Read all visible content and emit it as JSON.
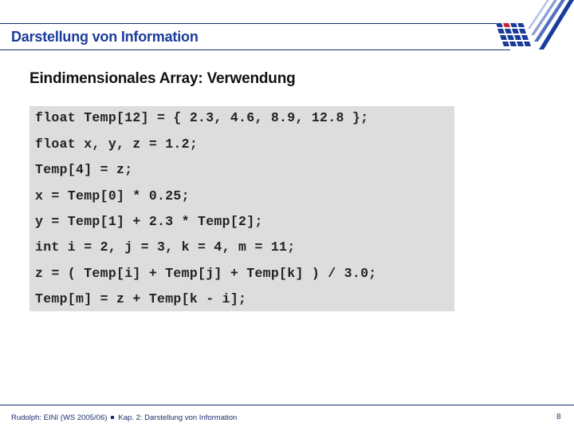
{
  "header": {
    "title": "Darstellung von Information",
    "logo": "university-logo"
  },
  "slide": {
    "subtitle": "Eindimensionales Array: Verwendung",
    "code_lines": [
      "float Temp[12] = { 2.3, 4.6, 8.9, 12.8 };",
      "float x, y, z = 1.2;",
      "Temp[4] = z;",
      "x = Temp[0] * 0.25;",
      "y = Temp[1] + 2.3 * Temp[2];",
      "int i = 2, j = 3, k = 4, m = 11;",
      "z = ( Temp[i] + Temp[j] + Temp[k] ) / 3.0;",
      "Temp[m] = z + Temp[k - i];"
    ]
  },
  "footer": {
    "left": "Rudolph: EINI (WS 2005/06)",
    "right": "Kap. 2: Darstellung von Information",
    "page": "8"
  },
  "colors": {
    "accent": "#1a3c99",
    "rule": "#1a2f6e",
    "code_bg": "#dddddd",
    "logo_red": "#cc1f2f"
  }
}
